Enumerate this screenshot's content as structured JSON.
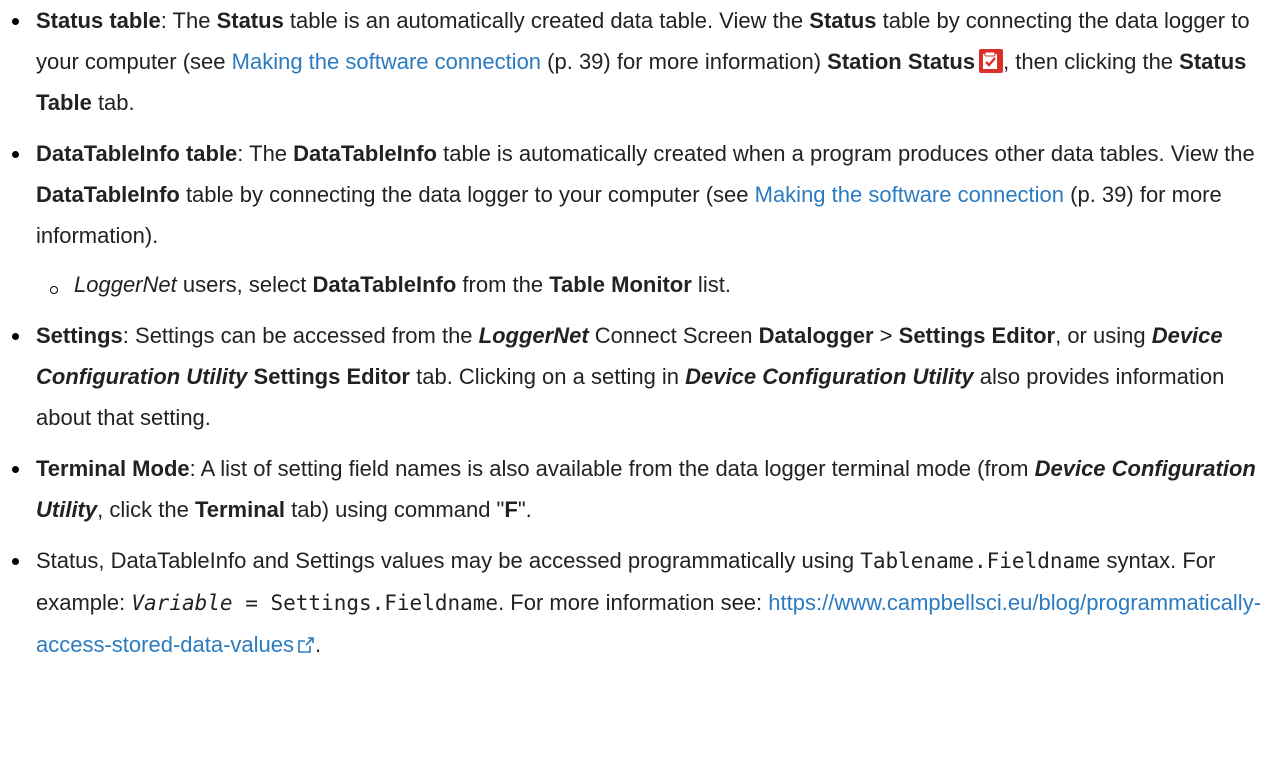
{
  "colors": {
    "text": "#222222",
    "link": "#2b7bc0",
    "icon_red": "#d9302a"
  },
  "bullets": {
    "status": {
      "lead": "Status table",
      "colon": ": The ",
      "t1": "Status",
      "t2": " table is an automatically created data table. View the ",
      "t3": "Status",
      "t4": " table by connecting the data logger to your computer (see ",
      "link": "Making the software connection",
      "t5": " (p. 39) for more information) ",
      "t6": "Station Status",
      "icon": "station-status-icon",
      "t7": ", then clicking the ",
      "t8": "Status Table",
      "t9": " tab."
    },
    "datatableinfo": {
      "lead": "DataTableInfo table",
      "colon": ": The ",
      "t1": "DataTableInfo",
      "t2": " table is automatically created when a program produces other data tables. View the ",
      "t3": "DataTableInfo",
      "t4": " table by connecting the data logger to your computer (see ",
      "link": "Making the software connection",
      "t5": " (p. 39) for more information).",
      "sub": {
        "app": "LoggerNet",
        "t1": " users, select ",
        "t2": "DataTableInfo",
        "t3": " from the ",
        "t4": "Table Monitor",
        "t5": " list."
      }
    },
    "settings": {
      "lead": "Settings",
      "t1": ": Settings can be accessed from the ",
      "app1": "LoggerNet",
      "t2": " Connect Screen ",
      "t3": "Datalogger",
      "t4": " > ",
      "t5": "Settings Editor",
      "t6": ", or using ",
      "app2": "Device Configuration Utility",
      "t7": " ",
      "t8": "Settings Editor",
      "t9": " tab. Clicking on a setting in ",
      "app3": "Device Configuration Utility",
      "t10": " also provides information about that setting."
    },
    "terminal": {
      "lead": "Terminal Mode",
      "t1": ": A list of setting field names is also available from the data logger terminal mode (from ",
      "app": "Device Configuration Utility",
      "t2": ", click the ",
      "t3": "Terminal",
      "t4": " tab) using command \"",
      "t5": "F",
      "t6": "\"."
    },
    "programmatic": {
      "t1": "Status, DataTableInfo and Settings values may be accessed programmatically using ",
      "code1": "Tablename.Fieldname",
      "t2": " syntax. For example: ",
      "code2": "Variable",
      "code3": " = Settings.Fieldname",
      "t3": ". For more information see: ",
      "link": "https://www.campbellsci.eu/blog/programmatically-access-stored-data-values",
      "icon": "external-link-icon",
      "t4": "."
    }
  }
}
